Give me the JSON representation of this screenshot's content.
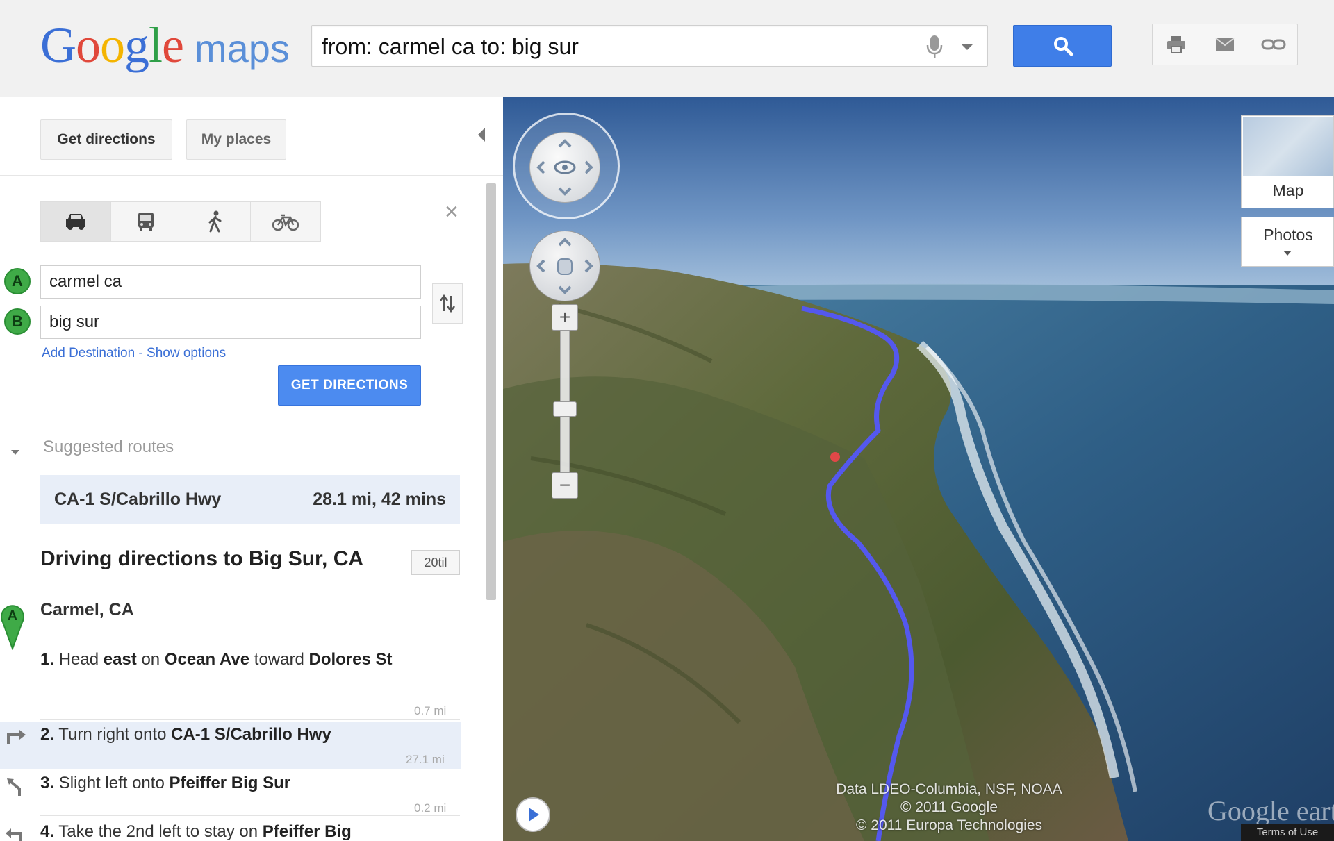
{
  "header": {
    "logo_google": [
      "G",
      "o",
      "o",
      "g",
      "l",
      "e"
    ],
    "logo_maps": "maps",
    "search_value": "from: carmel ca to: big sur",
    "search_icon": "magnifier-icon",
    "tools": [
      "print-icon",
      "email-icon",
      "link-icon"
    ]
  },
  "panel": {
    "get_directions_tab": "Get directions",
    "my_places_tab": "My places",
    "travel_modes": [
      "car-icon",
      "transit-icon",
      "walk-icon",
      "bike-icon"
    ],
    "waypoints": [
      {
        "marker": "A",
        "value": "carmel ca"
      },
      {
        "marker": "B",
        "value": "big sur"
      }
    ],
    "add_destination": "Add Destination",
    "link_separator": " - ",
    "show_options": "Show options",
    "get_directions_button": "GET DIRECTIONS",
    "suggested_routes_title": "Suggested routes",
    "route": {
      "name": "CA-1 S/Cabrillo Hwy",
      "summary": "28.1 mi, 42 mins"
    },
    "directions_title": "Driving directions to Big Sur, CA",
    "directions_badge": "20til",
    "start_marker": "A",
    "start_label": "Carmel, CA",
    "steps": [
      {
        "num": "1.",
        "parts": [
          "Head ",
          "east",
          " on ",
          "Ocean Ave",
          " toward ",
          "Dolores St"
        ],
        "distance": "0.7 mi"
      },
      {
        "num": "2.",
        "parts": [
          "Turn right onto ",
          "CA-1 S/Cabrillo Hwy"
        ],
        "distance": "27.1 mi"
      },
      {
        "num": "3.",
        "parts": [
          "Slight left onto ",
          "Pfeiffer Big Sur"
        ],
        "distance": "0.2 mi"
      },
      {
        "num": "4.",
        "parts": [
          "Take the 2nd left to stay on ",
          "Pfeiffer Big"
        ],
        "distance": ""
      }
    ]
  },
  "map": {
    "layer_map_label": "Map",
    "layer_photos_label": "Photos",
    "credits_line1": "Data LDEO-Columbia, NSF, NOAA",
    "credits_line2": "© 2011 Google",
    "credits_line3": "© 2011 Europa Technologies",
    "earth_logo": "Google earth",
    "terms": "Terms of Use",
    "route_color": "#4a4ee8"
  },
  "colors": {
    "accent": "#3f7ee8",
    "route_highlight": "#e8eef8",
    "marker_green": "#3faa47"
  }
}
